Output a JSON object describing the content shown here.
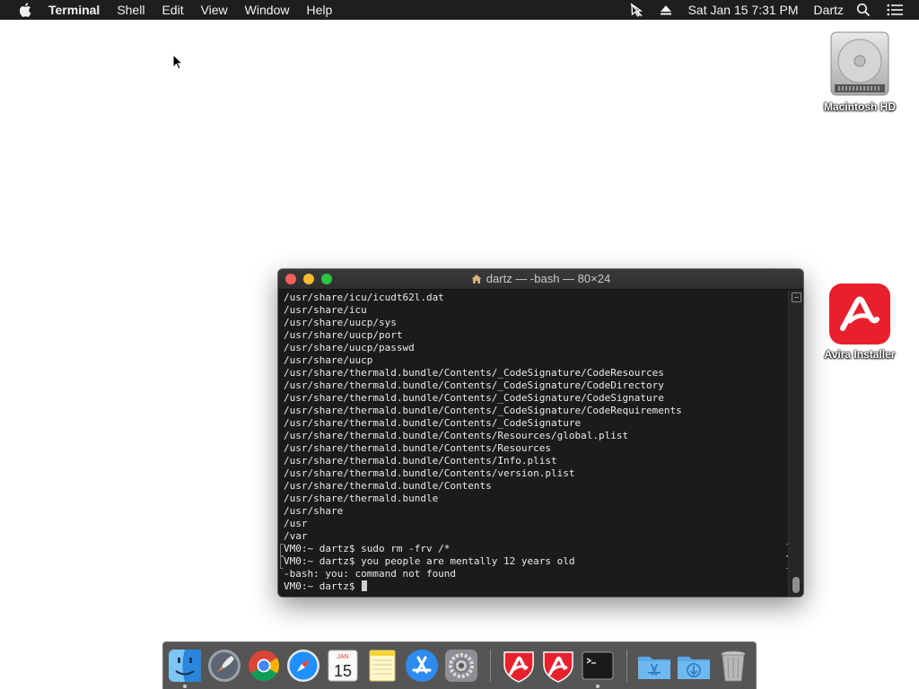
{
  "menubar": {
    "app_name": "Terminal",
    "items": [
      "Shell",
      "Edit",
      "View",
      "Window",
      "Help"
    ],
    "clock": "Sat Jan 15  7:31 PM",
    "user": "Dartz"
  },
  "desktop": {
    "icons": [
      {
        "label": "Macintosh HD"
      },
      {
        "label": "Avira Installer"
      }
    ]
  },
  "terminal": {
    "title": "dartz — -bash — 80×24",
    "lines": [
      "/usr/share/icu/icudt62l.dat",
      "/usr/share/icu",
      "/usr/share/uucp/sys",
      "/usr/share/uucp/port",
      "/usr/share/uucp/passwd",
      "/usr/share/uucp",
      "/usr/share/thermald.bundle/Contents/_CodeSignature/CodeResources",
      "/usr/share/thermald.bundle/Contents/_CodeSignature/CodeDirectory",
      "/usr/share/thermald.bundle/Contents/_CodeSignature/CodeSignature",
      "/usr/share/thermald.bundle/Contents/_CodeSignature/CodeRequirements",
      "/usr/share/thermald.bundle/Contents/_CodeSignature",
      "/usr/share/thermald.bundle/Contents/Resources/global.plist",
      "/usr/share/thermald.bundle/Contents/Resources",
      "/usr/share/thermald.bundle/Contents/Info.plist",
      "/usr/share/thermald.bundle/Contents/version.plist",
      "/usr/share/thermald.bundle/Contents",
      "/usr/share/thermald.bundle",
      "/usr/share",
      "/usr",
      "/var",
      "VM0:~ dartz$ sudo rm -frv /*",
      "VM0:~ dartz$ you people are mentally 12 years old",
      "-bash: you: command not found"
    ],
    "prompt": "VM0:~ dartz$ "
  },
  "dock": {
    "calendar_month": "JAN",
    "calendar_day": "15",
    "items": [
      {
        "icon": "finder-icon",
        "running": true
      },
      {
        "icon": "launchpad-icon",
        "running": false
      },
      {
        "icon": "chrome-icon",
        "running": false
      },
      {
        "icon": "safari-icon",
        "running": false
      },
      {
        "icon": "calendar-icon",
        "running": false
      },
      {
        "icon": "notes-icon",
        "running": false
      },
      {
        "icon": "app-store-icon",
        "running": false
      },
      {
        "icon": "system-preferences-icon",
        "running": false
      },
      {
        "icon": "avira-icon",
        "running": false
      },
      {
        "icon": "avira-icon",
        "running": false
      },
      {
        "icon": "terminal-icon",
        "running": true
      },
      {
        "icon": "applications-folder-icon",
        "running": false
      },
      {
        "icon": "downloads-folder-icon",
        "running": false
      },
      {
        "icon": "trash-icon",
        "running": false
      }
    ]
  }
}
